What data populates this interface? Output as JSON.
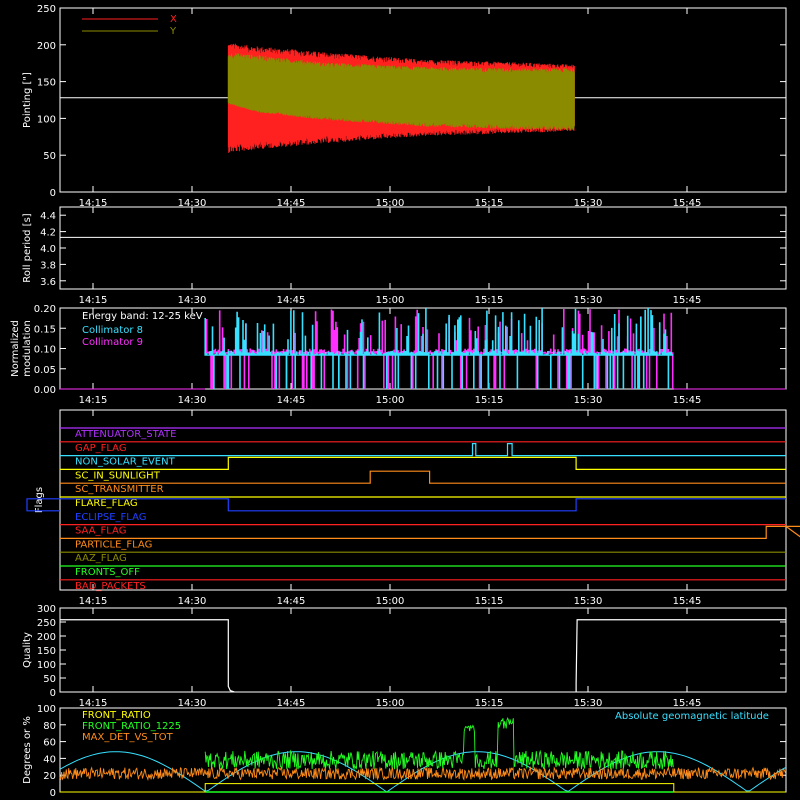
{
  "colors": {
    "red": "#ff2020",
    "olive": "#8b8b00",
    "white": "#ffffff",
    "cyan": "#38e0ff",
    "magenta": "#ff30ff",
    "green": "#22ff22",
    "orange": "#ff8c1a",
    "yellow": "#ffff00",
    "blue": "#2040ff",
    "darkyellow": "#8b8b00",
    "purple": "#b030ff"
  },
  "chart_data": [
    {
      "type": "line",
      "panel": "pointing",
      "ylabel": "Pointing [\"]",
      "ylim": [
        0,
        250
      ],
      "yticks": [
        0,
        50,
        100,
        150,
        200,
        250
      ],
      "xticks": [
        "14:15",
        "14:30",
        "14:45",
        "15:00",
        "15:15",
        "15:30",
        "15:45"
      ],
      "xlim_min": [
        5,
        115
      ],
      "reference_line": 128,
      "series": [
        {
          "name": "X",
          "color": "red",
          "x_min": [
            30.5,
            83
          ],
          "center": 128,
          "envelope": [
            [
              30.5,
              75,
              20
            ],
            [
              35,
              70,
              26
            ],
            [
              45,
              62,
              35
            ],
            [
              60,
              52,
              47
            ],
            [
              75,
              48,
              53
            ],
            [
              83,
              45,
              55
            ]
          ]
        },
        {
          "name": "Y",
          "color": "olive",
          "x_min": [
            30.5,
            83
          ],
          "center": 128,
          "envelope": [
            [
              30.5,
              62,
              8
            ],
            [
              35,
              58,
              20
            ],
            [
              45,
              48,
              30
            ],
            [
              60,
              42,
              39
            ],
            [
              75,
              40,
              43
            ],
            [
              83,
              40,
              44
            ]
          ]
        }
      ]
    },
    {
      "type": "line",
      "panel": "roll",
      "ylabel": "Roll period [s]",
      "ylim": [
        3.5,
        4.5
      ],
      "yticks": [
        "3.6",
        "3.8",
        "4.0",
        "4.2",
        "4.4"
      ],
      "xticks": [
        "14:15",
        "14:30",
        "14:45",
        "15:00",
        "15:15",
        "15:30",
        "15:45"
      ],
      "value": 4.13
    },
    {
      "type": "line",
      "panel": "modulation",
      "ylabel": "Normalized modulation",
      "ylim": [
        0,
        0.2
      ],
      "yticks": [
        "0.00",
        "0.05",
        "0.10",
        "0.15",
        "0.20"
      ],
      "xticks": [
        "14:15",
        "14:30",
        "14:45",
        "15:00",
        "15:15",
        "15:30",
        "15:45"
      ],
      "annotation": "Energy band: 12-25 keV",
      "x_min": [
        27,
        98
      ],
      "series": [
        {
          "name": "Collimator 8",
          "color": "cyan",
          "base": 0.09
        },
        {
          "name": "Collimator 9",
          "color": "magenta",
          "base": 0.095
        }
      ]
    },
    {
      "type": "line",
      "panel": "flags",
      "ylabel": "Flags",
      "xticks": [
        "14:15",
        "14:30",
        "14:45",
        "15:00",
        "15:15",
        "15:30",
        "15:45"
      ],
      "flags": [
        {
          "name": "ATTENUATOR_STATE",
          "color": "purple",
          "steps": []
        },
        {
          "name": "GAP_FLAG",
          "color": "red",
          "steps": []
        },
        {
          "name": "NON_SOLAR_EVENT",
          "color": "cyan",
          "steps": [
            [
              67.5,
              68.0
            ],
            [
              72.8,
              73.5
            ]
          ]
        },
        {
          "name": "SC_IN_SUNLIGHT",
          "color": "yellow",
          "steps": [
            [
              30.5,
              83.2
            ]
          ]
        },
        {
          "name": "SC_TRANSMITTER",
          "color": "orange",
          "steps": [
            [
              52,
              61
            ]
          ]
        },
        {
          "name": "FLARE_FLAG",
          "color": "yellow",
          "steps": []
        },
        {
          "name": "ECLIPSE_FLAG",
          "color": "blue",
          "steps": [
            [
              0,
              30.5
            ],
            [
              83.2,
              115
            ]
          ]
        },
        {
          "name": "SAA_FLAG",
          "color": "red",
          "steps": []
        },
        {
          "name": "PARTICLE_FLAG",
          "color": "orange",
          "steps": [
            [
              112,
              115.2
            ],
            [
              117.5,
              120
            ]
          ]
        },
        {
          "name": "AAZ_FLAG",
          "color": "darkyellow",
          "steps": []
        },
        {
          "name": "FRONTS_OFF",
          "color": "green",
          "steps": []
        },
        {
          "name": "BAD_PACKETS",
          "color": "red",
          "steps": []
        }
      ]
    },
    {
      "type": "line",
      "panel": "quality",
      "ylabel": "Quality",
      "ylim": [
        0,
        300
      ],
      "yticks": [
        0,
        50,
        100,
        150,
        200,
        250,
        300
      ],
      "xticks": [
        "14:15",
        "14:30",
        "14:45",
        "15:00",
        "15:15",
        "15:30",
        "15:45"
      ],
      "high": 258,
      "segments": [
        [
          0,
          30.5
        ],
        [
          83.2,
          115
        ]
      ]
    },
    {
      "type": "line",
      "panel": "ratios",
      "ylabel": "Degrees or %",
      "ylim": [
        0,
        100
      ],
      "yticks": [
        0,
        20,
        40,
        60,
        80,
        100
      ],
      "series": [
        {
          "name": "FRONT_RATIO",
          "color": "yellow"
        },
        {
          "name": "FRONT_RATIO_1225",
          "color": "green"
        },
        {
          "name": "MAX_DET_VS_TOT",
          "color": "orange"
        },
        {
          "name": "Absolute geomagnetic latitude",
          "color": "cyan"
        }
      ]
    }
  ]
}
